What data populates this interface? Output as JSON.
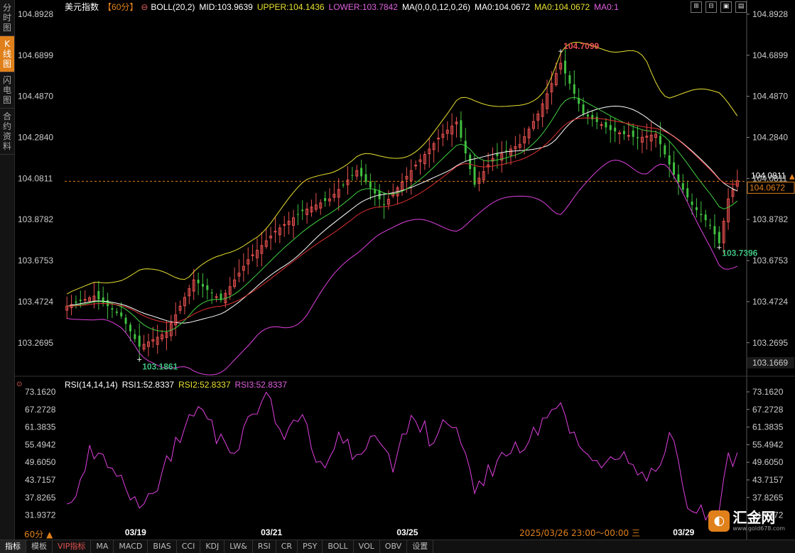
{
  "side_tabs": [
    {
      "label": "分时图",
      "active": false
    },
    {
      "label": "K线图",
      "active": true
    },
    {
      "label": "闪电图",
      "active": false
    },
    {
      "label": "合约资料",
      "active": false
    }
  ],
  "header": {
    "title": "美元指数",
    "period": "【60分】",
    "boll": "BOLL(20,2)",
    "mid": "MID:103.9639",
    "upper": "UPPER:104.1436",
    "lower": "LOWER:103.7842",
    "ma": "MA(0,0,0,12,0,26)",
    "ma0a": "MA0:104.0672",
    "ma0b": "MA0:104.0672",
    "ma0c": "MA0:1"
  },
  "rsi_header": {
    "name": "RSI(14,14,14)",
    "rsi1": "RSI1:52.8337",
    "rsi2": "RSI2:52.8337",
    "rsi3": "RSI3:52.8337"
  },
  "window_buttons": [
    "⊞",
    "⊟",
    "▣",
    "▤"
  ],
  "timeframe": "60分 ▲",
  "datetime": "2025/03/26 23:00～00:00 三",
  "bottom_tabs": [
    "指标",
    "模板",
    "VIP指标",
    "MA",
    "MACD",
    "BIAS",
    "CCI",
    "KDJ",
    "LW&",
    "RSI",
    "CR",
    "PSY",
    "BOLL",
    "VOL",
    "OBV",
    "设置"
  ],
  "logo": {
    "name": "汇金网",
    "url": "www.gold678.com"
  },
  "colors": {
    "up": "#e85050",
    "down": "#40c040",
    "upper": "#e8e030",
    "lower": "#e040e0",
    "mid": "#ffffff",
    "ma12": "#40d040",
    "ma26": "#e03030",
    "rsi": "#e040e0",
    "accent": "#e0801a"
  },
  "chart_data": {
    "type": "candlestick",
    "ylim": [
      103.1669,
      104.8928
    ],
    "y_ticks": [
      "104.8928",
      "104.6899",
      "104.4870",
      "104.2840",
      "104.0811",
      "103.8782",
      "103.6753",
      "103.4724",
      "103.2695"
    ],
    "y_bottom_label": "103.1669",
    "x_ticks": [
      {
        "label": "03/19",
        "index": 15
      },
      {
        "label": "03/21",
        "index": 45
      },
      {
        "label": "03/25",
        "index": 75
      },
      {
        "label": "03/29",
        "index": 136
      }
    ],
    "current_price": "104.0672",
    "last_label": "104.0811",
    "high_marker": {
      "label": "104.7099",
      "index": 109,
      "value": 104.7099
    },
    "low_marker": {
      "label": "103.1861",
      "index": 16,
      "value": 103.1861
    },
    "low_marker2": {
      "label": "103.7396",
      "index": 144,
      "value": 103.7396
    },
    "key_closes": [
      [
        0,
        103.45
      ],
      [
        6,
        103.5
      ],
      [
        12,
        103.4
      ],
      [
        16,
        103.25
      ],
      [
        22,
        103.32
      ],
      [
        28,
        103.58
      ],
      [
        34,
        103.48
      ],
      [
        40,
        103.68
      ],
      [
        46,
        103.82
      ],
      [
        52,
        103.92
      ],
      [
        58,
        103.98
      ],
      [
        64,
        104.12
      ],
      [
        70,
        103.95
      ],
      [
        76,
        104.12
      ],
      [
        82,
        104.28
      ],
      [
        86,
        104.36
      ],
      [
        90,
        104.05
      ],
      [
        94,
        104.18
      ],
      [
        100,
        104.25
      ],
      [
        104,
        104.4
      ],
      [
        109,
        104.65
      ],
      [
        114,
        104.4
      ],
      [
        120,
        104.32
      ],
      [
        126,
        104.28
      ],
      [
        130,
        104.3
      ],
      [
        134,
        104.1
      ],
      [
        138,
        103.95
      ],
      [
        142,
        103.85
      ],
      [
        144,
        103.76
      ],
      [
        146,
        103.98
      ],
      [
        148,
        104.07
      ]
    ],
    "rsi": {
      "ylim": [
        29.0,
        73.162
      ],
      "y_ticks": [
        "73.1620",
        "67.2728",
        "61.3835",
        "55.4942",
        "49.6050",
        "43.7157",
        "37.8265",
        "31.9372"
      ],
      "key_values": [
        [
          0,
          33
        ],
        [
          5,
          52
        ],
        [
          9,
          48
        ],
        [
          13,
          40
        ],
        [
          16,
          34
        ],
        [
          20,
          42
        ],
        [
          24,
          55
        ],
        [
          28,
          68
        ],
        [
          32,
          62
        ],
        [
          36,
          50
        ],
        [
          40,
          64
        ],
        [
          44,
          72
        ],
        [
          48,
          58
        ],
        [
          52,
          66
        ],
        [
          56,
          48
        ],
        [
          60,
          58
        ],
        [
          64,
          50
        ],
        [
          68,
          60
        ],
        [
          72,
          46
        ],
        [
          76,
          67
        ],
        [
          80,
          58
        ],
        [
          84,
          62
        ],
        [
          88,
          55
        ],
        [
          90,
          40
        ],
        [
          94,
          48
        ],
        [
          98,
          52
        ],
        [
          102,
          58
        ],
        [
          106,
          65
        ],
        [
          109,
          70
        ],
        [
          113,
          52
        ],
        [
          118,
          47
        ],
        [
          122,
          52
        ],
        [
          126,
          45
        ],
        [
          130,
          48
        ],
        [
          134,
          60
        ],
        [
          137,
          36
        ],
        [
          140,
          32
        ],
        [
          142,
          31
        ],
        [
          144,
          36
        ],
        [
          146,
          50
        ],
        [
          148,
          52.8337
        ]
      ]
    }
  }
}
